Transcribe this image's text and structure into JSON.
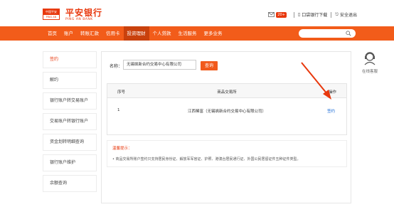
{
  "header": {
    "logo_badge_top": "中国平安",
    "logo_badge_bottom": "PING AN",
    "bank_name": "平安银行",
    "bank_name_en": "PING AN BANK",
    "message_count": "20+",
    "download_label": "口袋银行下载",
    "logout_label": "安全退出"
  },
  "nav": {
    "items": [
      {
        "label": "首页"
      },
      {
        "label": "账户"
      },
      {
        "label": "转账汇款"
      },
      {
        "label": "信用卡"
      },
      {
        "label": "投资理财"
      },
      {
        "label": "个人贷款"
      },
      {
        "label": "生活服务"
      },
      {
        "label": "更多业务"
      }
    ],
    "active_index": 4
  },
  "sidebar": {
    "items": [
      {
        "label": "签约"
      },
      {
        "label": "解约"
      },
      {
        "label": "银行账户转交易账户"
      },
      {
        "label": "交易账户转银行账户"
      },
      {
        "label": "资金划转明细查询"
      },
      {
        "label": "银行账户维护"
      },
      {
        "label": "余额查询"
      }
    ],
    "active_index": 0
  },
  "search": {
    "name_label": "名称：",
    "name_value": "无锡飒新合约交易中心有限公司",
    "query_button": "查询"
  },
  "table": {
    "headers": [
      "序号",
      "商品交易所",
      "操作"
    ],
    "rows": [
      {
        "index": "1",
        "exchange": "江西稀富（无锡飒新合约交易中心有限公司）",
        "action": "签约"
      }
    ]
  },
  "tips": {
    "title": "温馨提示：",
    "text": "• 商品交易所账户签约只支持居民身份证、解放军军官证、护照、港澳台居民通行证、外国公民居留证件五种证件类型。"
  },
  "service": {
    "label": "在线客服"
  },
  "colors": {
    "brand": "#e8380d",
    "nav_bg": "#f25c1a",
    "link": "#1a6bd6"
  }
}
